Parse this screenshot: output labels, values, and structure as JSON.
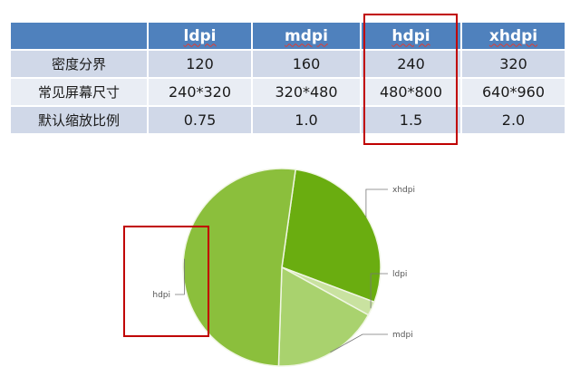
{
  "table": {
    "columns": [
      "",
      "ldpi",
      "mdpi",
      "hdpi",
      "xhdpi"
    ],
    "rows": [
      {
        "label": "密度分界",
        "cells": [
          "120",
          "160",
          "240",
          "320"
        ]
      },
      {
        "label": "常见屏幕尺寸",
        "cells": [
          "240*320",
          "320*480",
          "480*800",
          "640*960"
        ]
      },
      {
        "label": "默认缩放比例",
        "cells": [
          "0.75",
          "1.0",
          "1.5",
          "2.0"
        ]
      }
    ]
  },
  "highlight_color": "#c00000",
  "chart_data": {
    "type": "pie",
    "title": "",
    "start_angle_deg": -82,
    "slices": [
      {
        "label": "xhdpi",
        "value": 28.5,
        "color": "#6aad10"
      },
      {
        "label": "ldpi",
        "value": 2.3,
        "color": "#c9e2a0"
      },
      {
        "label": "mdpi",
        "value": 17.5,
        "color": "#a9d26e"
      },
      {
        "label": "hdpi",
        "value": 51.7,
        "color": "#8bbf3c"
      }
    ],
    "slice_border_color": "#f0f6e4",
    "leader_line_color": "#777777"
  }
}
